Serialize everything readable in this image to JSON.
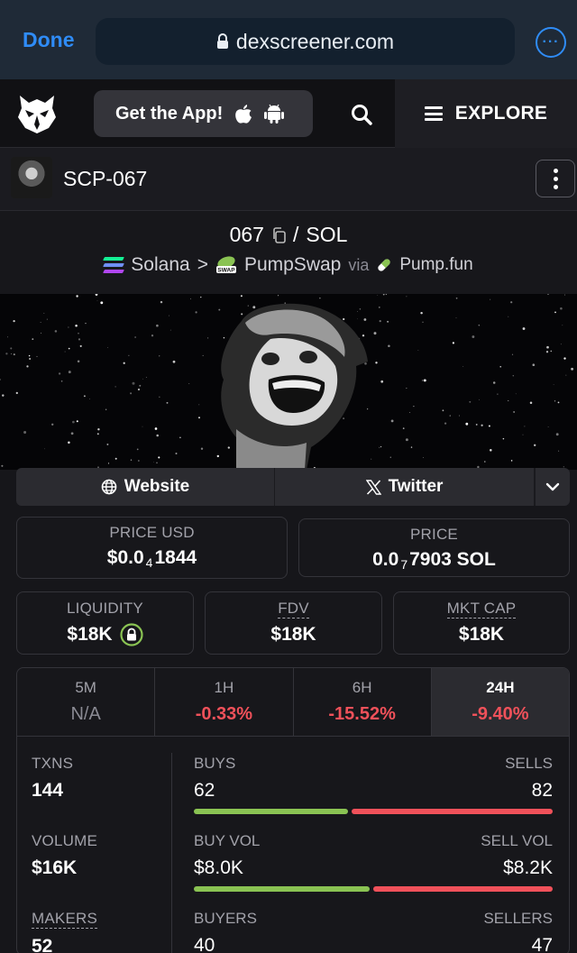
{
  "browser": {
    "done_label": "Done",
    "url": "dexscreener.com"
  },
  "header": {
    "get_app_label": "Get the App!",
    "explore_label": "EXPLORE"
  },
  "token": {
    "name": "SCP-067"
  },
  "pair": {
    "base": "067",
    "separator": "/",
    "quote": "SOL",
    "chain": "Solana",
    "chevron": ">",
    "dex": "PumpSwap",
    "via": "via",
    "launchpad": "Pump.fun",
    "swap_badge": "SWAP"
  },
  "links": {
    "website": "Website",
    "twitter": "Twitter"
  },
  "prices": {
    "price_usd_label": "PRICE USD",
    "price_usd_prefix": "$0.0",
    "price_usd_zeros": "4",
    "price_usd_digits": "1844",
    "price_label": "PRICE",
    "price_prefix": "0.0",
    "price_zeros": "7",
    "price_digits": "7903 SOL"
  },
  "metrics": {
    "liquidity_label": "LIQUIDITY",
    "liquidity_value": "$18K",
    "fdv_label": "FDV",
    "fdv_value": "$18K",
    "mktcap_label": "MKT CAP",
    "mktcap_value": "$18K"
  },
  "timeframes": [
    {
      "name": "5M",
      "change": "N/A"
    },
    {
      "name": "1H",
      "change": "-0.33%"
    },
    {
      "name": "6H",
      "change": "-15.52%"
    },
    {
      "name": "24H",
      "change": "-9.40%"
    }
  ],
  "stats": {
    "txns_label": "TXNS",
    "txns_value": "144",
    "buys_label": "BUYS",
    "buys_value": "62",
    "sells_label": "SELLS",
    "sells_value": "82",
    "buys_fraction": 0.43,
    "volume_label": "VOLUME",
    "volume_value": "$16K",
    "buy_vol_label": "BUY VOL",
    "buy_vol_value": "$8.0K",
    "sell_vol_label": "SELL VOL",
    "sell_vol_value": "$8.2K",
    "buy_vol_fraction": 0.49,
    "makers_label": "MAKERS",
    "makers_value": "52",
    "buyers_label": "BUYERS",
    "buyers_value": "40",
    "sellers_label": "SELLERS",
    "sellers_value": "47"
  },
  "colors": {
    "accent_blue": "#2f8cf7",
    "negative": "#f0515a",
    "positive": "#8ac353"
  }
}
